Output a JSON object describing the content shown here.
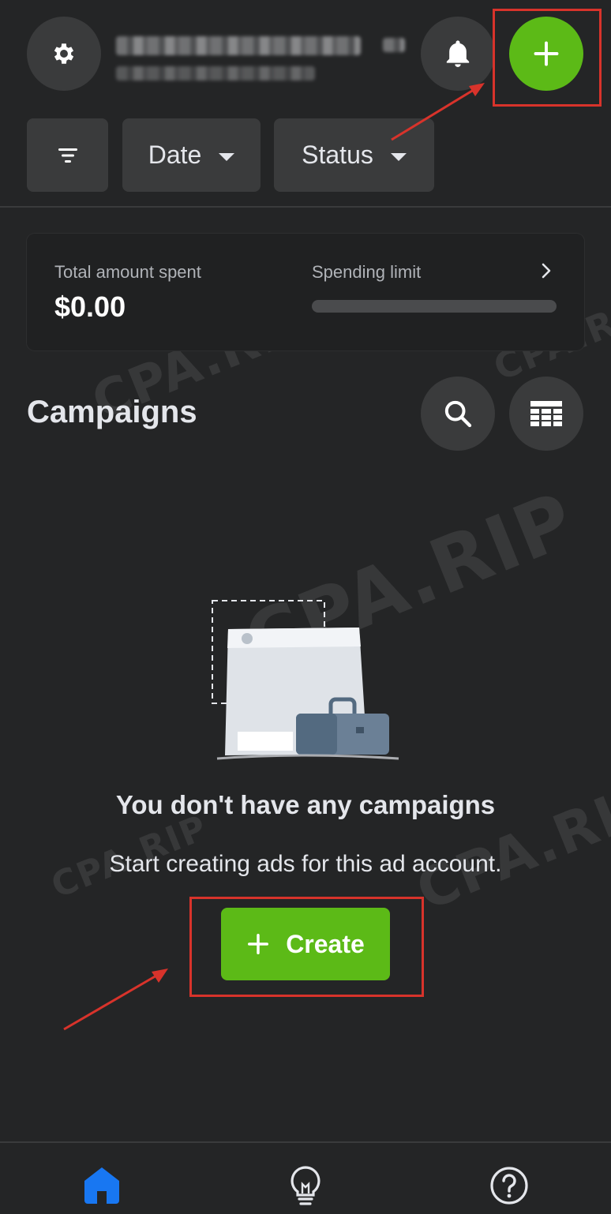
{
  "header": {
    "settings_icon": "gear-icon",
    "notifications_icon": "bell-icon",
    "add_icon": "plus-icon"
  },
  "filters": {
    "filter_icon": "filter-lines-icon",
    "date_label": "Date",
    "status_label": "Status"
  },
  "spend_card": {
    "total_label": "Total amount spent",
    "total_value": "$0.00",
    "limit_label": "Spending limit",
    "limit_used_fraction": 0
  },
  "campaigns": {
    "title": "Campaigns",
    "search_icon": "search-icon",
    "table_icon": "table-icon"
  },
  "empty_state": {
    "title": "You don't have any campaigns",
    "subtitle": "Start creating ads for this ad account.",
    "create_label": "Create"
  },
  "bottom_nav": {
    "items": [
      {
        "name": "home",
        "icon": "home-icon",
        "active": true
      },
      {
        "name": "tips",
        "icon": "lightbulb-icon",
        "active": false
      },
      {
        "name": "help",
        "icon": "help-icon",
        "active": false
      }
    ]
  },
  "watermark": {
    "text": "CPA.RIP"
  },
  "colors": {
    "background": "#242526",
    "surface": "#3a3b3c",
    "accent_green": "#5cba17",
    "annotation_red": "#d8332b",
    "active_blue": "#1877f2"
  }
}
